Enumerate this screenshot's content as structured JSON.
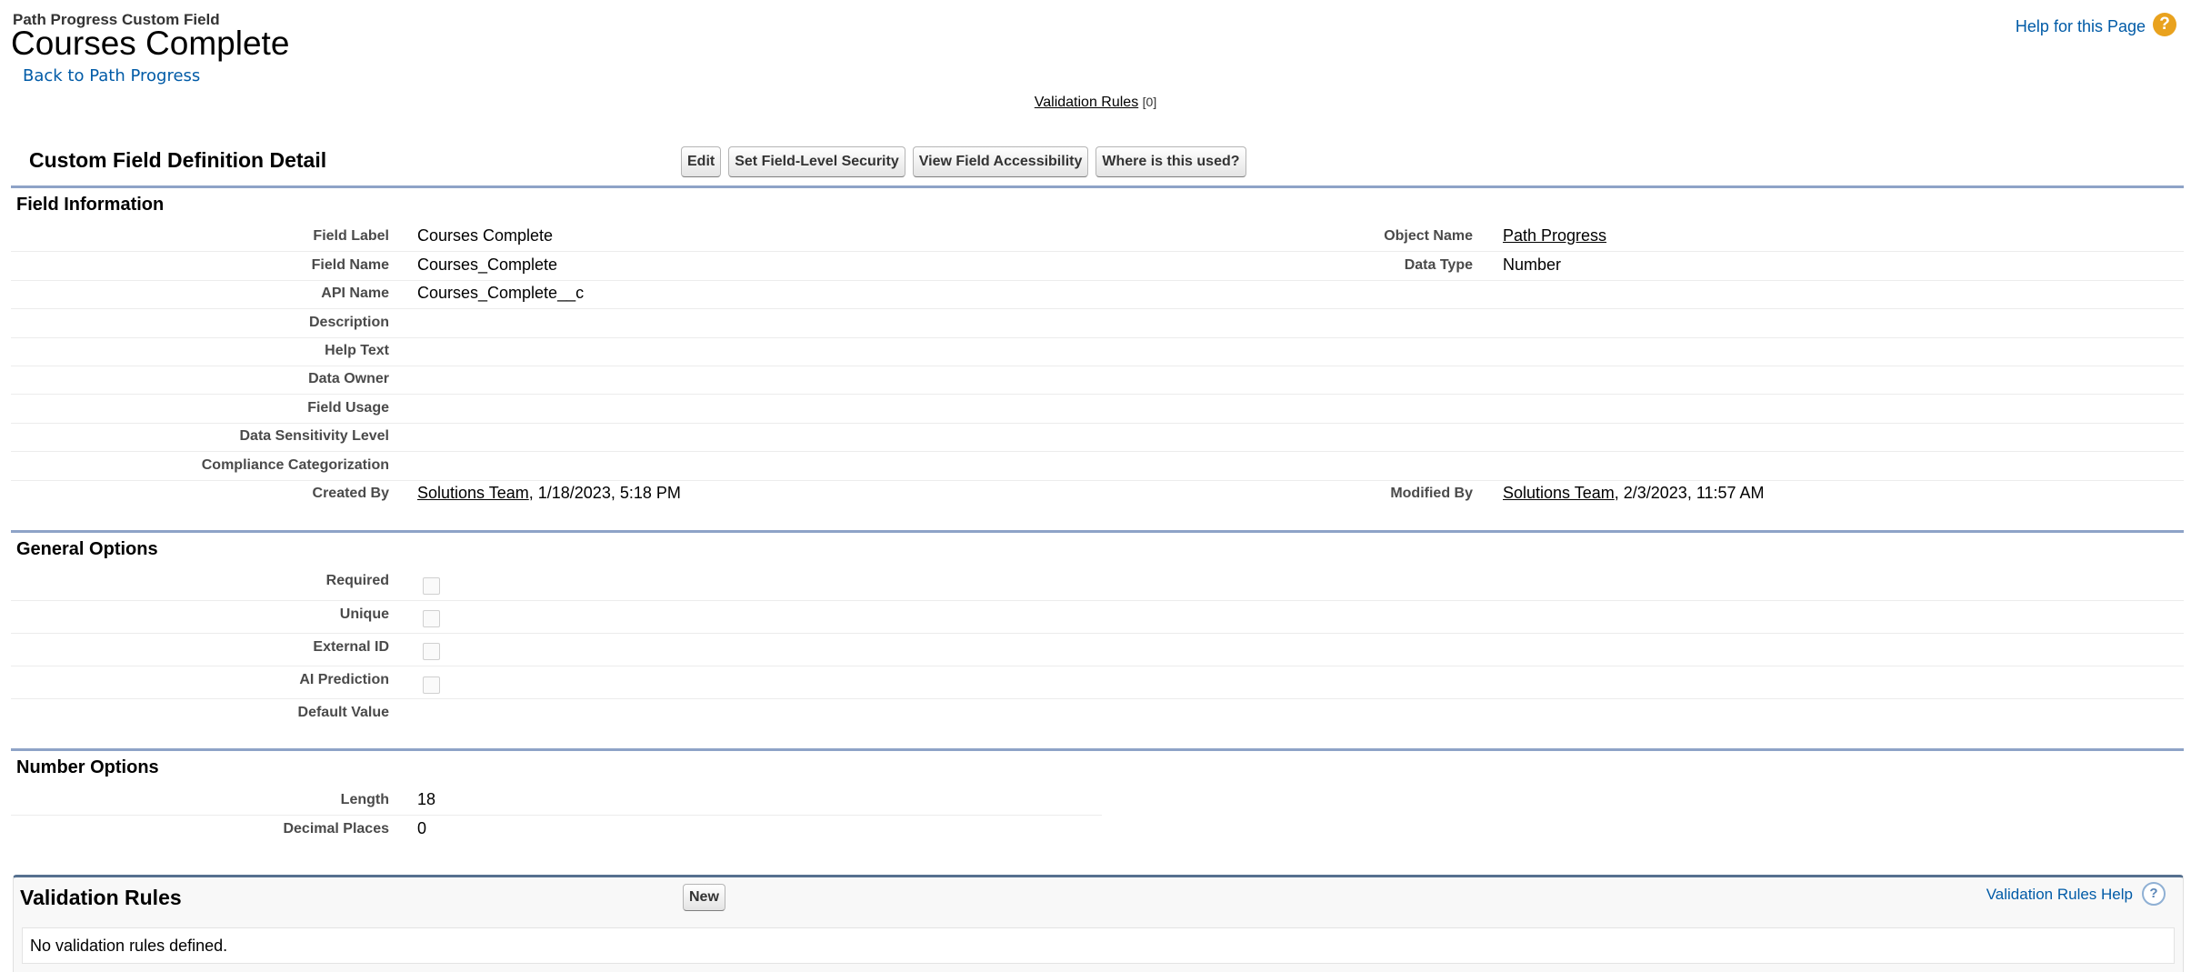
{
  "header": {
    "object_type": "Path Progress Custom Field",
    "title": "Courses Complete",
    "back_link": "Back to Path Progress",
    "help_link": "Help for this Page",
    "help_icon": "?"
  },
  "related_links": {
    "validation_rules_label": "Validation Rules",
    "validation_rules_count": "[0]"
  },
  "detail": {
    "title": "Custom Field Definition Detail",
    "buttons": {
      "edit": "Edit",
      "fls": "Set Field-Level Security",
      "accessibility": "View Field Accessibility",
      "where_used": "Where is this used?"
    }
  },
  "field_info": {
    "section_title": "Field Information",
    "field_label_label": "Field Label",
    "field_label_value": "Courses Complete",
    "object_name_label": "Object Name",
    "object_name_value": "Path Progress",
    "field_name_label": "Field Name",
    "field_name_value": "Courses_Complete",
    "data_type_label": "Data Type",
    "data_type_value": "Number",
    "api_name_label": "API Name",
    "api_name_value": "Courses_Complete__c",
    "description_label": "Description",
    "help_text_label": "Help Text",
    "data_owner_label": "Data Owner",
    "field_usage_label": "Field Usage",
    "sensitivity_label": "Data Sensitivity Level",
    "compliance_label": "Compliance Categorization",
    "created_by_label": "Created By",
    "created_by_user": "Solutions Team",
    "created_by_date": ", 1/18/2023, 5:18 PM",
    "modified_by_label": "Modified By",
    "modified_by_user": "Solutions Team",
    "modified_by_date": ", 2/3/2023, 11:57 AM"
  },
  "general_options": {
    "section_title": "General Options",
    "required_label": "Required",
    "unique_label": "Unique",
    "external_id_label": "External ID",
    "ai_prediction_label": "AI Prediction",
    "default_value_label": "Default Value"
  },
  "number_options": {
    "section_title": "Number Options",
    "length_label": "Length",
    "length_value": "18",
    "decimal_label": "Decimal Places",
    "decimal_value": "0"
  },
  "validation_list": {
    "title": "Validation Rules",
    "new_button": "New",
    "help_link": "Validation Rules Help",
    "help_icon": "?",
    "empty_text": "No validation rules defined."
  }
}
